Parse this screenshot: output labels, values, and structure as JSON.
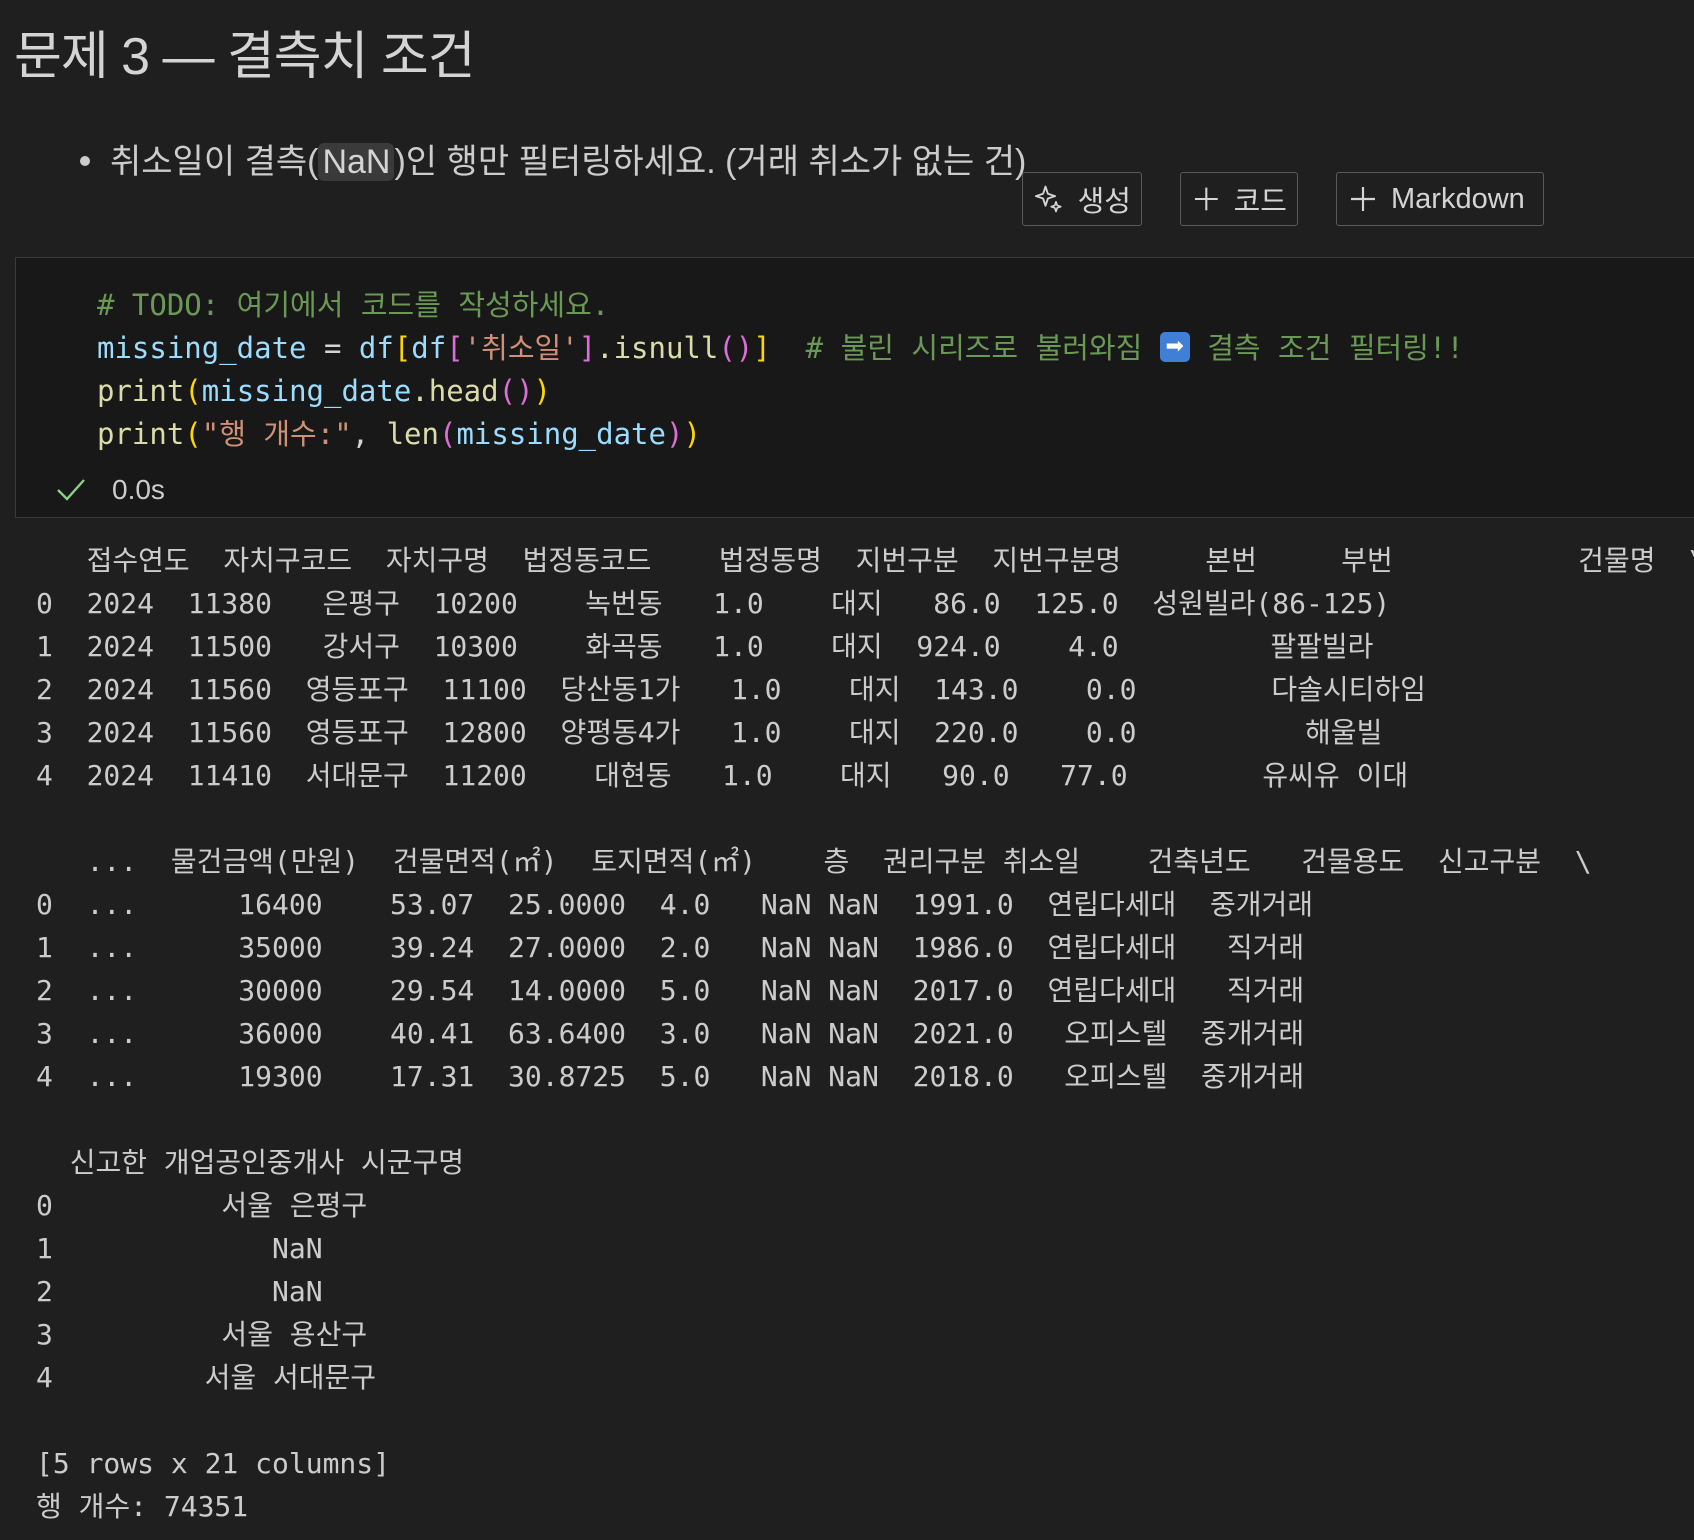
{
  "heading": "문제 3 — 결측치 조건",
  "instruction": {
    "before": "취소일이 결측(",
    "code": "NaN",
    "after": ")인 행만 필터링하세요. (거래 취소가 없는 건)"
  },
  "toolbar": {
    "generate_label": "생성",
    "code_label": "코드",
    "markdown_label": "Markdown"
  },
  "code_cell": {
    "l1_comment": "# TODO: 여기에서 코드를 작성하세요.",
    "l2_var": "missing_date",
    "l2_eq": " = ",
    "l2_df1": "df",
    "l2_df2": "df",
    "l2_str": "'취소일'",
    "l2_method": ".isnull",
    "l2_comment_a": "# 불린 시리즈로 불러와짐 ",
    "l2_comment_b": " 결측 조건 필터링!!",
    "l3_fn": "print",
    "l3_var": "missing_date",
    "l3_method": ".head",
    "l4_fn": "print",
    "l4_str": "\"행 개수:\"",
    "l4_fn2": "len",
    "l4_var": "missing_date",
    "exec_time": "0.0s"
  },
  "output_lines": [
    "   접수연도  자치구코드  자치구명  법정동코드    법정동명  지번구분  지번구분명     본번     부번           건물명  \\",
    "0  2024  11380   은평구  10200    녹번동   1.0    대지   86.0  125.0  성원빌라(86-125)",
    "1  2024  11500   강서구  10300    화곡동   1.0    대지  924.0    4.0         팔팔빌라",
    "2  2024  11560  영등포구  11100  당산동1가   1.0    대지  143.0    0.0        다솔시티하임",
    "3  2024  11560  영등포구  12800  양평동4가   1.0    대지  220.0    0.0          해울빌",
    "4  2024  11410  서대문구  11200    대현동   1.0    대지   90.0   77.0        유씨유 이대",
    "",
    "   ...  물건금액(만원)  건물면적(㎡)  토지면적(㎡)    층  권리구분 취소일    건축년도   건물용도  신고구분  \\",
    "0  ...      16400    53.07  25.0000  4.0   NaN NaN  1991.0  연립다세대  중개거래",
    "1  ...      35000    39.24  27.0000  2.0   NaN NaN  1986.0  연립다세대   직거래",
    "2  ...      30000    29.54  14.0000  5.0   NaN NaN  2017.0  연립다세대   직거래",
    "3  ...      36000    40.41  63.6400  3.0   NaN NaN  2021.0   오피스텔  중개거래",
    "4  ...      19300    17.31  30.8725  5.0   NaN NaN  2018.0   오피스텔  중개거래",
    "",
    "  신고한 개업공인중개사 시군구명",
    "0          서울 은평구",
    "1             NaN",
    "2             NaN",
    "3          서울 용산구",
    "4         서울 서대문구",
    "",
    "[5 rows x 21 columns]",
    "행 개수: 74351"
  ]
}
